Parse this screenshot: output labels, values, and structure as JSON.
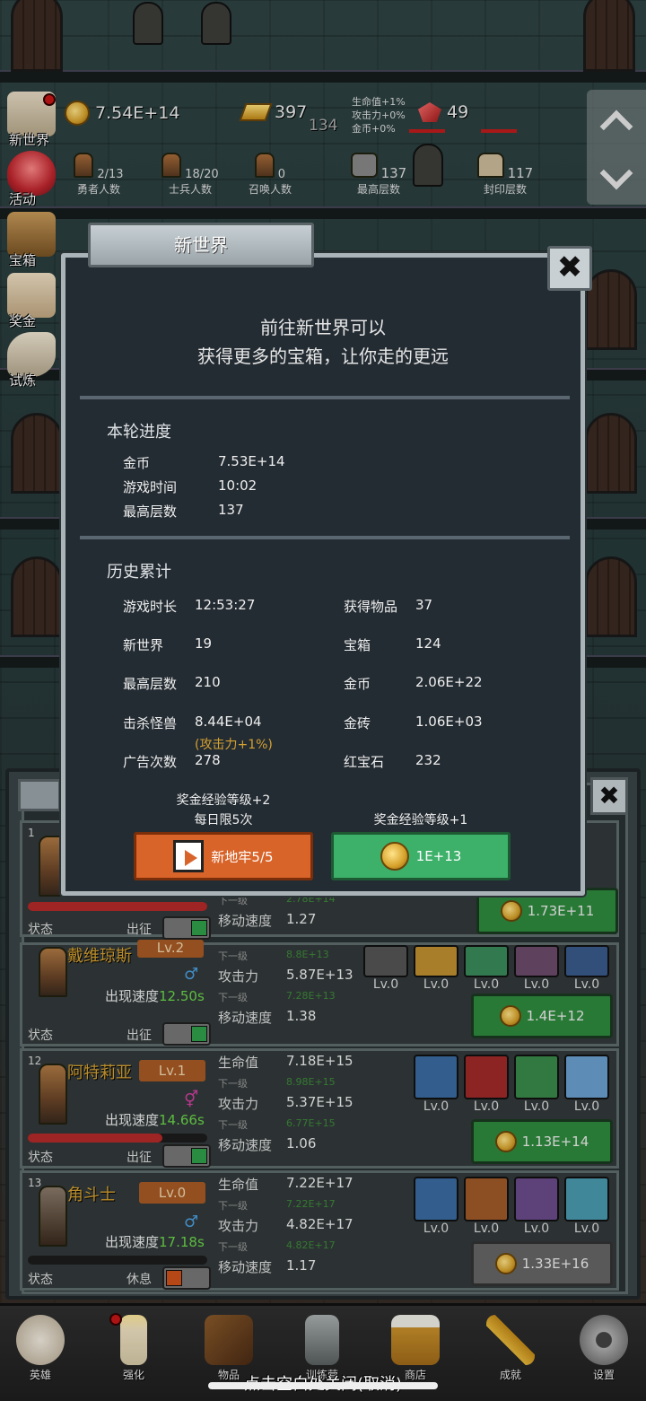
{
  "hud": {
    "gold": "7.54E+14",
    "gold_bars": "397",
    "sub_value": "134",
    "buffs": [
      "生命值+1%",
      "攻击力+0%",
      "金币+0%"
    ],
    "rubies": "49",
    "counts": [
      {
        "value": "2/13",
        "label": "勇者人数"
      },
      {
        "value": "18/20",
        "label": "士兵人数"
      },
      {
        "value": "0",
        "label": "召唤人数"
      },
      {
        "value": "137",
        "label": "最高层数"
      },
      {
        "value": "117",
        "label": "封印层数"
      }
    ]
  },
  "side_menu": [
    "新世界",
    "活动",
    "宝箱",
    "奖金",
    "试炼"
  ],
  "modal": {
    "title": "新世界",
    "close": "✖",
    "intro_line1": "前往新世界可以",
    "intro_line2": "获得更多的宝箱，让你走的更远",
    "current": {
      "title": "本轮进度",
      "rows": [
        {
          "k": "金币",
          "v": "7.53E+14"
        },
        {
          "k": "游戏时间",
          "v": "10:02"
        },
        {
          "k": "最高层数",
          "v": "137"
        }
      ]
    },
    "history": {
      "title": "历史累计",
      "left": [
        {
          "k": "游戏时长",
          "v": "12:53:27"
        },
        {
          "k": "新世界",
          "v": "19"
        },
        {
          "k": "最高层数",
          "v": "210"
        },
        {
          "k": "击杀怪兽",
          "v": "8.44E+04"
        },
        {
          "k": "广告次数",
          "v": "278"
        }
      ],
      "kill_note": "(攻击力+1%)",
      "right": [
        {
          "k": "获得物品",
          "v": "37"
        },
        {
          "k": "宝箱",
          "v": "124"
        },
        {
          "k": "金币",
          "v": "2.06E+22"
        },
        {
          "k": "金砖",
          "v": "1.06E+03"
        },
        {
          "k": "红宝石",
          "v": "232"
        }
      ]
    },
    "reward_left_1": "奖金经验等级+2",
    "reward_left_2": "每日限5次",
    "reward_right": "奖金经验等级+1",
    "btn_ad": "新地牢5/5",
    "btn_gold": "1E+13"
  },
  "heroes": [
    {
      "num": "1",
      "name": "",
      "level": "",
      "gender": "",
      "speed_label": "",
      "speed": "",
      "hp_fill": 1.0,
      "state": "状态",
      "action": "出征",
      "toggle": "on",
      "stats": [
        {
          "k": "",
          "v": ""
        },
        {
          "k": "下一级",
          "v": "2.78E+14"
        },
        {
          "k": "移动速度",
          "v": "1.27"
        }
      ],
      "skills": [],
      "cost": "1.73E+11",
      "cost_style": "green"
    },
    {
      "num": "",
      "name": "戴维琼斯",
      "level": "Lv.2",
      "gender": "♂",
      "speed_label": "出现速度",
      "speed": "12.50s",
      "hp_fill": 0,
      "state": "状态",
      "action": "出征",
      "toggle": "on",
      "stats": [
        {
          "k": "下一级",
          "v": "8.8E+13"
        },
        {
          "k": "攻击力",
          "v": "5.87E+13"
        },
        {
          "k": "下一级",
          "v": "7.28E+13"
        },
        {
          "k": "移动速度",
          "v": "1.38"
        }
      ],
      "skills": [
        "Lv.0",
        "Lv.0",
        "Lv.0",
        "Lv.0",
        "Lv.0"
      ],
      "cost": "1.4E+12",
      "cost_style": "green"
    },
    {
      "num": "12",
      "name": "阿特莉亚",
      "level": "Lv.1",
      "gender": "⚥",
      "speed_label": "出现速度",
      "speed": "14.66s",
      "hp_fill": 0.75,
      "state": "状态",
      "action": "出征",
      "toggle": "on",
      "stats": [
        {
          "k": "生命值",
          "v": "7.18E+15"
        },
        {
          "k": "下一级",
          "v": "8.98E+15"
        },
        {
          "k": "攻击力",
          "v": "5.37E+15"
        },
        {
          "k": "下一级",
          "v": "6.77E+15"
        },
        {
          "k": "移动速度",
          "v": "1.06"
        }
      ],
      "skills": [
        "Lv.0",
        "Lv.0",
        "Lv.0",
        "Lv.0"
      ],
      "cost": "1.13E+14",
      "cost_style": "green"
    },
    {
      "num": "13",
      "name": "角斗士",
      "level": "Lv.0",
      "gender": "♂",
      "speed_label": "出现速度",
      "speed": "17.18s",
      "hp_fill": 0,
      "state": "状态",
      "action": "休息",
      "toggle": "off",
      "stats": [
        {
          "k": "生命值",
          "v": "7.22E+17"
        },
        {
          "k": "下一级",
          "v": "7.22E+17"
        },
        {
          "k": "攻击力",
          "v": "4.82E+17"
        },
        {
          "k": "下一级",
          "v": "4.82E+17"
        },
        {
          "k": "移动速度",
          "v": "1.17"
        }
      ],
      "skills": [
        "Lv.0",
        "Lv.0",
        "Lv.0",
        "Lv.0"
      ],
      "cost": "1.33E+16",
      "cost_style": "gray"
    }
  ],
  "bottom_nav": [
    "英雄",
    "强化",
    "物品",
    "训练营",
    "商店",
    "成就",
    "设置"
  ],
  "close_hint": "点击空白处关闭(取消)",
  "colors": {
    "accent_green": "#3db06a",
    "accent_orange": "#d8642a",
    "gold_text": "#d4a030"
  }
}
